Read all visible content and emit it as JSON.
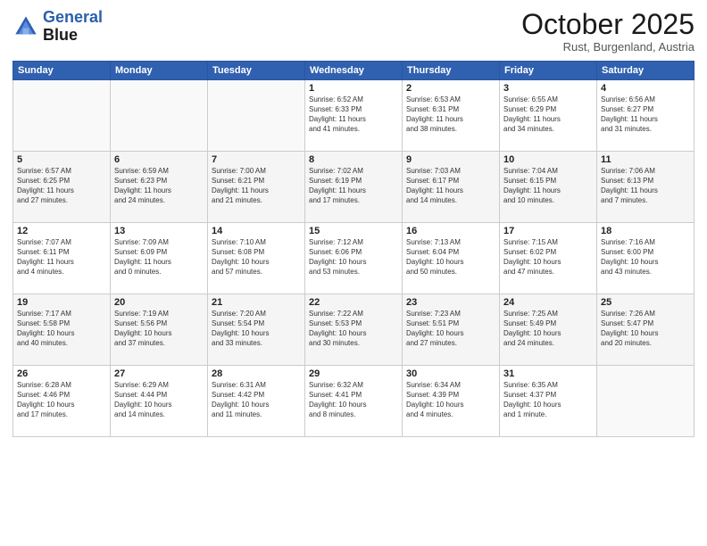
{
  "header": {
    "logo_line1": "General",
    "logo_line2": "Blue",
    "month": "October 2025",
    "location": "Rust, Burgenland, Austria"
  },
  "weekdays": [
    "Sunday",
    "Monday",
    "Tuesday",
    "Wednesday",
    "Thursday",
    "Friday",
    "Saturday"
  ],
  "weeks": [
    [
      {
        "day": "",
        "info": ""
      },
      {
        "day": "",
        "info": ""
      },
      {
        "day": "",
        "info": ""
      },
      {
        "day": "1",
        "info": "Sunrise: 6:52 AM\nSunset: 6:33 PM\nDaylight: 11 hours\nand 41 minutes."
      },
      {
        "day": "2",
        "info": "Sunrise: 6:53 AM\nSunset: 6:31 PM\nDaylight: 11 hours\nand 38 minutes."
      },
      {
        "day": "3",
        "info": "Sunrise: 6:55 AM\nSunset: 6:29 PM\nDaylight: 11 hours\nand 34 minutes."
      },
      {
        "day": "4",
        "info": "Sunrise: 6:56 AM\nSunset: 6:27 PM\nDaylight: 11 hours\nand 31 minutes."
      }
    ],
    [
      {
        "day": "5",
        "info": "Sunrise: 6:57 AM\nSunset: 6:25 PM\nDaylight: 11 hours\nand 27 minutes."
      },
      {
        "day": "6",
        "info": "Sunrise: 6:59 AM\nSunset: 6:23 PM\nDaylight: 11 hours\nand 24 minutes."
      },
      {
        "day": "7",
        "info": "Sunrise: 7:00 AM\nSunset: 6:21 PM\nDaylight: 11 hours\nand 21 minutes."
      },
      {
        "day": "8",
        "info": "Sunrise: 7:02 AM\nSunset: 6:19 PM\nDaylight: 11 hours\nand 17 minutes."
      },
      {
        "day": "9",
        "info": "Sunrise: 7:03 AM\nSunset: 6:17 PM\nDaylight: 11 hours\nand 14 minutes."
      },
      {
        "day": "10",
        "info": "Sunrise: 7:04 AM\nSunset: 6:15 PM\nDaylight: 11 hours\nand 10 minutes."
      },
      {
        "day": "11",
        "info": "Sunrise: 7:06 AM\nSunset: 6:13 PM\nDaylight: 11 hours\nand 7 minutes."
      }
    ],
    [
      {
        "day": "12",
        "info": "Sunrise: 7:07 AM\nSunset: 6:11 PM\nDaylight: 11 hours\nand 4 minutes."
      },
      {
        "day": "13",
        "info": "Sunrise: 7:09 AM\nSunset: 6:09 PM\nDaylight: 11 hours\nand 0 minutes."
      },
      {
        "day": "14",
        "info": "Sunrise: 7:10 AM\nSunset: 6:08 PM\nDaylight: 10 hours\nand 57 minutes."
      },
      {
        "day": "15",
        "info": "Sunrise: 7:12 AM\nSunset: 6:06 PM\nDaylight: 10 hours\nand 53 minutes."
      },
      {
        "day": "16",
        "info": "Sunrise: 7:13 AM\nSunset: 6:04 PM\nDaylight: 10 hours\nand 50 minutes."
      },
      {
        "day": "17",
        "info": "Sunrise: 7:15 AM\nSunset: 6:02 PM\nDaylight: 10 hours\nand 47 minutes."
      },
      {
        "day": "18",
        "info": "Sunrise: 7:16 AM\nSunset: 6:00 PM\nDaylight: 10 hours\nand 43 minutes."
      }
    ],
    [
      {
        "day": "19",
        "info": "Sunrise: 7:17 AM\nSunset: 5:58 PM\nDaylight: 10 hours\nand 40 minutes."
      },
      {
        "day": "20",
        "info": "Sunrise: 7:19 AM\nSunset: 5:56 PM\nDaylight: 10 hours\nand 37 minutes."
      },
      {
        "day": "21",
        "info": "Sunrise: 7:20 AM\nSunset: 5:54 PM\nDaylight: 10 hours\nand 33 minutes."
      },
      {
        "day": "22",
        "info": "Sunrise: 7:22 AM\nSunset: 5:53 PM\nDaylight: 10 hours\nand 30 minutes."
      },
      {
        "day": "23",
        "info": "Sunrise: 7:23 AM\nSunset: 5:51 PM\nDaylight: 10 hours\nand 27 minutes."
      },
      {
        "day": "24",
        "info": "Sunrise: 7:25 AM\nSunset: 5:49 PM\nDaylight: 10 hours\nand 24 minutes."
      },
      {
        "day": "25",
        "info": "Sunrise: 7:26 AM\nSunset: 5:47 PM\nDaylight: 10 hours\nand 20 minutes."
      }
    ],
    [
      {
        "day": "26",
        "info": "Sunrise: 6:28 AM\nSunset: 4:46 PM\nDaylight: 10 hours\nand 17 minutes."
      },
      {
        "day": "27",
        "info": "Sunrise: 6:29 AM\nSunset: 4:44 PM\nDaylight: 10 hours\nand 14 minutes."
      },
      {
        "day": "28",
        "info": "Sunrise: 6:31 AM\nSunset: 4:42 PM\nDaylight: 10 hours\nand 11 minutes."
      },
      {
        "day": "29",
        "info": "Sunrise: 6:32 AM\nSunset: 4:41 PM\nDaylight: 10 hours\nand 8 minutes."
      },
      {
        "day": "30",
        "info": "Sunrise: 6:34 AM\nSunset: 4:39 PM\nDaylight: 10 hours\nand 4 minutes."
      },
      {
        "day": "31",
        "info": "Sunrise: 6:35 AM\nSunset: 4:37 PM\nDaylight: 10 hours\nand 1 minute."
      },
      {
        "day": "",
        "info": ""
      }
    ]
  ]
}
